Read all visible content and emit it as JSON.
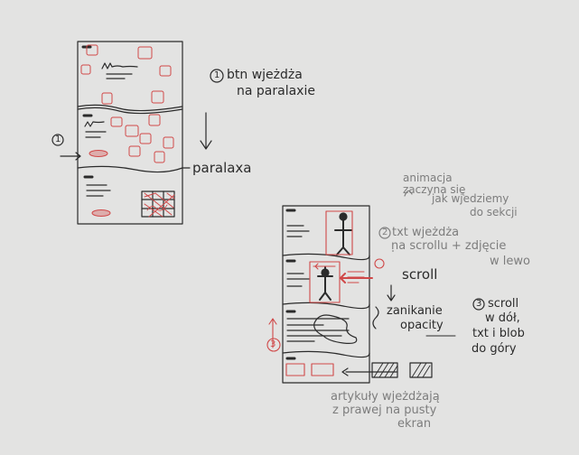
{
  "left_sketch": {
    "marker_1": "1",
    "note_title": "btn wjeżdża",
    "note_sub": "na paralaxie",
    "arrow_label": "paralaxa"
  },
  "right_sketch": {
    "anim_note": [
      "animacja",
      "zaczyna się",
      "jak wjedziemy",
      "do sekcji"
    ],
    "marker_2": "2",
    "note_2": [
      "txt wjeżdża",
      "na scrollu + zdjęcie",
      "w lewo"
    ],
    "scroll_label": "scroll",
    "fade_note": [
      "zanikanie",
      "opacity"
    ],
    "marker_3": "3",
    "note_3": [
      "scroll",
      "w dół,",
      "txt i blob",
      "do góry"
    ],
    "bottom_note": [
      "artykuły wjeżdżają",
      "z prawej na pusty",
      "ekran"
    ]
  },
  "colors": {
    "ink": "#2b2b2b",
    "red": "#d04848",
    "gray": "#7d7d7d",
    "paper": "#e3e3e2"
  }
}
